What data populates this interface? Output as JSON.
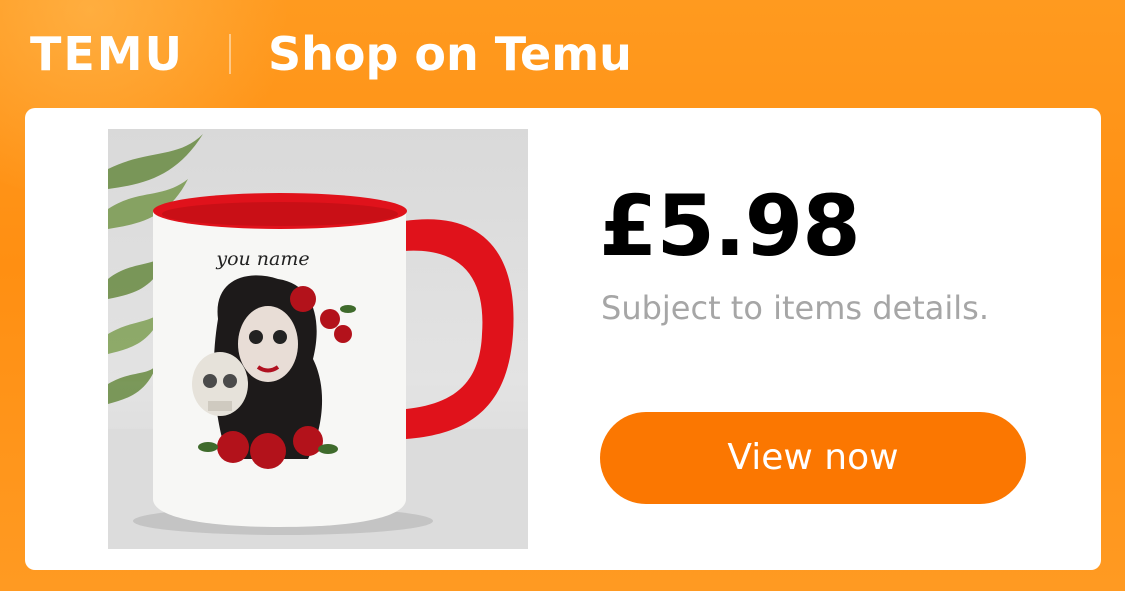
{
  "header": {
    "logo_text": "TEMU",
    "title": "Shop on Temu"
  },
  "product": {
    "mug_text": "you name",
    "price": "£5.98",
    "subtext": "Subject to items details.",
    "cta_label": "View now"
  },
  "colors": {
    "brand_orange": "#fb7701",
    "banner_orange": "#ff8f12",
    "mug_accent_red": "#e0121b"
  },
  "icons": [
    "temu-logo",
    "mug-image"
  ]
}
